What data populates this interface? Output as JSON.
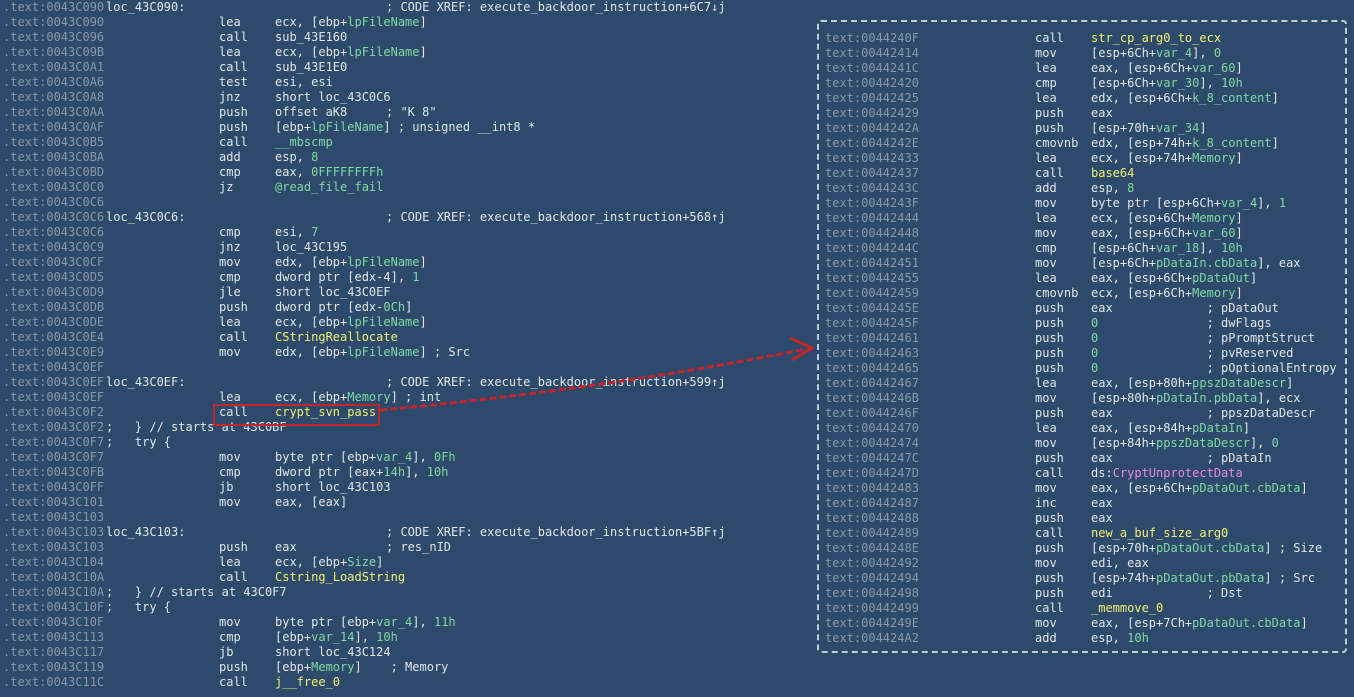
{
  "listing": [
    {
      "a": ".text:0043C090",
      "l": "loc_43C090:",
      "c": "; CODE XREF: execute_backdoor_instruction+6C7↓j"
    },
    {
      "a": ".text:0043C090",
      "m": "lea",
      "o": [
        [
          "ecx, [ebp+",
          "p"
        ],
        [
          "lpFileName",
          "s"
        ],
        [
          "]",
          "p"
        ]
      ]
    },
    {
      "a": ".text:0043C096",
      "m": "call",
      "o": [
        [
          "sub_43E160",
          "p"
        ]
      ]
    },
    {
      "a": ".text:0043C09B",
      "m": "lea",
      "o": [
        [
          "ecx, [ebp+",
          "p"
        ],
        [
          "lpFileName",
          "s"
        ],
        [
          "]",
          "p"
        ]
      ]
    },
    {
      "a": ".text:0043C0A1",
      "m": "call",
      "o": [
        [
          "sub_43E1E0",
          "p"
        ]
      ]
    },
    {
      "a": ".text:0043C0A6",
      "m": "test",
      "o": [
        [
          "esi, esi",
          "p"
        ]
      ]
    },
    {
      "a": ".text:0043C0A8",
      "m": "jnz",
      "o": [
        [
          "short loc_43C0C6",
          "p"
        ]
      ]
    },
    {
      "a": ".text:0043C0AA",
      "m": "push",
      "o": [
        [
          "offset aK8",
          "p"
        ]
      ],
      "c": "; \"K 8\""
    },
    {
      "a": ".text:0043C0AF",
      "m": "push",
      "o": [
        [
          "[ebp+",
          "p"
        ],
        [
          "lpFileName",
          "s"
        ],
        [
          "] ; unsigned __int8 *",
          "p"
        ]
      ]
    },
    {
      "a": ".text:0043C0B5",
      "m": "call",
      "o": [
        [
          "__mbscmp",
          "s"
        ]
      ]
    },
    {
      "a": ".text:0043C0BA",
      "m": "add",
      "o": [
        [
          "esp, ",
          "p"
        ],
        [
          "8",
          "s"
        ]
      ]
    },
    {
      "a": ".text:0043C0BD",
      "m": "cmp",
      "o": [
        [
          "eax, ",
          "p"
        ],
        [
          "0FFFFFFFFh",
          "s"
        ]
      ]
    },
    {
      "a": ".text:0043C0C0",
      "m": "jz",
      "o": [
        [
          "@read_file_fail",
          "s"
        ]
      ]
    },
    {
      "a": ".text:0043C0C6"
    },
    {
      "a": ".text:0043C0C6",
      "l": "loc_43C0C6:",
      "c": "; CODE XREF: execute_backdoor_instruction+568↑j"
    },
    {
      "a": ".text:0043C0C6",
      "m": "cmp",
      "o": [
        [
          "esi, ",
          "p"
        ],
        [
          "7",
          "s"
        ]
      ]
    },
    {
      "a": ".text:0043C0C9",
      "m": "jnz",
      "o": [
        [
          "loc_43C195",
          "p"
        ]
      ]
    },
    {
      "a": ".text:0043C0CF",
      "m": "mov",
      "o": [
        [
          "edx, [ebp+",
          "p"
        ],
        [
          "lpFileName",
          "s"
        ],
        [
          "]",
          "p"
        ]
      ]
    },
    {
      "a": ".text:0043C0D5",
      "m": "cmp",
      "o": [
        [
          "dword ptr [edx-4], ",
          "p"
        ],
        [
          "1",
          "s"
        ]
      ]
    },
    {
      "a": ".text:0043C0D9",
      "m": "jle",
      "o": [
        [
          "short loc_43C0EF",
          "p"
        ]
      ]
    },
    {
      "a": ".text:0043C0DB",
      "m": "push",
      "o": [
        [
          "dword ptr [edx-",
          "p"
        ],
        [
          "0Ch",
          "s"
        ],
        [
          "]",
          "p"
        ]
      ]
    },
    {
      "a": ".text:0043C0DE",
      "m": "lea",
      "o": [
        [
          "ecx, [ebp+",
          "p"
        ],
        [
          "lpFileName",
          "s"
        ],
        [
          "]",
          "p"
        ]
      ]
    },
    {
      "a": ".text:0043C0E4",
      "m": "call",
      "o": [
        [
          "CStringReallocate",
          "f"
        ]
      ]
    },
    {
      "a": ".text:0043C0E9",
      "m": "mov",
      "o": [
        [
          "edx, [ebp+",
          "p"
        ],
        [
          "lpFileName",
          "s"
        ],
        [
          "] ; Src",
          "p"
        ]
      ]
    },
    {
      "a": ".text:0043C0EF"
    },
    {
      "a": ".text:0043C0EF",
      "l": "loc_43C0EF:",
      "c": "; CODE XREF: execute_backdoor_instruction+599↑j"
    },
    {
      "a": ".text:0043C0EF",
      "m": "lea",
      "o": [
        [
          "ecx, [ebp+",
          "p"
        ],
        [
          "Memory",
          "s"
        ],
        [
          "] ; int",
          "p"
        ]
      ]
    },
    {
      "a": ".text:0043C0F2",
      "m": "call",
      "o": [
        [
          "crypt_svn_pass",
          "f"
        ]
      ]
    },
    {
      "a": ".text:0043C0F2",
      "t": ";   } // starts at 43C0BF"
    },
    {
      "a": ".text:0043C0F7",
      "t": ";   try {"
    },
    {
      "a": ".text:0043C0F7",
      "m": "mov",
      "o": [
        [
          "byte ptr [ebp+",
          "p"
        ],
        [
          "var_4",
          "s"
        ],
        [
          "], ",
          "p"
        ],
        [
          "0Fh",
          "s"
        ]
      ]
    },
    {
      "a": ".text:0043C0FB",
      "m": "cmp",
      "o": [
        [
          "dword ptr [eax+",
          "p"
        ],
        [
          "14h",
          "s"
        ],
        [
          "], ",
          "p"
        ],
        [
          "10h",
          "s"
        ]
      ]
    },
    {
      "a": ".text:0043C0FF",
      "m": "jb",
      "o": [
        [
          "short loc_43C103",
          "p"
        ]
      ]
    },
    {
      "a": ".text:0043C101",
      "m": "mov",
      "o": [
        [
          "eax, [eax]",
          "p"
        ]
      ]
    },
    {
      "a": ".text:0043C103"
    },
    {
      "a": ".text:0043C103",
      "l": "loc_43C103:",
      "c": "; CODE XREF: execute_backdoor_instruction+5BF↑j"
    },
    {
      "a": ".text:0043C103",
      "m": "push",
      "o": [
        [
          "eax",
          "p"
        ]
      ],
      "c": "; res_nID"
    },
    {
      "a": ".text:0043C104",
      "m": "lea",
      "o": [
        [
          "ecx, [ebp+",
          "p"
        ],
        [
          "Size",
          "s"
        ],
        [
          "]",
          "p"
        ]
      ]
    },
    {
      "a": ".text:0043C10A",
      "m": "call",
      "o": [
        [
          "Cstring_LoadString",
          "f"
        ]
      ]
    },
    {
      "a": ".text:0043C10A",
      "t": ";   } // starts at 43C0F7"
    },
    {
      "a": ".text:0043C10F",
      "t": ";   try {"
    },
    {
      "a": ".text:0043C10F",
      "m": "mov",
      "o": [
        [
          "byte ptr [ebp+",
          "p"
        ],
        [
          "var_4",
          "s"
        ],
        [
          "], ",
          "p"
        ],
        [
          "11h",
          "s"
        ]
      ]
    },
    {
      "a": ".text:0043C113",
      "m": "cmp",
      "o": [
        [
          "[ebp+",
          "p"
        ],
        [
          "var_14",
          "s"
        ],
        [
          "], ",
          "p"
        ],
        [
          "10h",
          "s"
        ]
      ]
    },
    {
      "a": ".text:0043C117",
      "m": "jb",
      "o": [
        [
          "short loc_43C124",
          "p"
        ]
      ]
    },
    {
      "a": ".text:0043C119",
      "m": "push",
      "o": [
        [
          "[ebp+",
          "p"
        ],
        [
          "Memory",
          "s"
        ],
        [
          "]    ; Memory",
          "p"
        ]
      ]
    },
    {
      "a": ".text:0043C11C",
      "m": "call",
      "o": [
        [
          "j__free_0",
          "f"
        ]
      ]
    }
  ],
  "popup": [
    {
      "a": "text:0044240F",
      "m": "call",
      "o": [
        [
          "str_cp_arg0_to_ecx",
          "f"
        ]
      ]
    },
    {
      "a": "text:00442414",
      "m": "mov",
      "o": [
        [
          "[esp+6Ch+",
          "p"
        ],
        [
          "var_4",
          "s"
        ],
        [
          "], ",
          "p"
        ],
        [
          "0",
          "s"
        ]
      ]
    },
    {
      "a": "text:0044241C",
      "m": "lea",
      "o": [
        [
          "eax, [esp+6Ch+",
          "p"
        ],
        [
          "var_60",
          "s"
        ],
        [
          "]",
          "p"
        ]
      ]
    },
    {
      "a": "text:00442420",
      "m": "cmp",
      "o": [
        [
          "[esp+6Ch+",
          "p"
        ],
        [
          "var_30",
          "s"
        ],
        [
          "], ",
          "p"
        ],
        [
          "10h",
          "s"
        ]
      ]
    },
    {
      "a": "text:00442425",
      "m": "lea",
      "o": [
        [
          "edx, [esp+6Ch+",
          "p"
        ],
        [
          "k_8_content",
          "s"
        ],
        [
          "]",
          "p"
        ]
      ]
    },
    {
      "a": "text:00442429",
      "m": "push",
      "o": [
        [
          "eax",
          "p"
        ]
      ]
    },
    {
      "a": "text:0044242A",
      "m": "push",
      "o": [
        [
          "[esp+70h+",
          "p"
        ],
        [
          "var_34",
          "s"
        ],
        [
          "]",
          "p"
        ]
      ]
    },
    {
      "a": "text:0044242E",
      "m": "cmovnb",
      "o": [
        [
          "edx, [esp+74h+",
          "p"
        ],
        [
          "k_8_content",
          "s"
        ],
        [
          "]",
          "p"
        ]
      ]
    },
    {
      "a": "text:00442433",
      "m": "lea",
      "o": [
        [
          "ecx, [esp+74h+",
          "p"
        ],
        [
          "Memory",
          "s"
        ],
        [
          "]",
          "p"
        ]
      ]
    },
    {
      "a": "text:00442437",
      "m": "call",
      "o": [
        [
          "base64",
          "f"
        ]
      ]
    },
    {
      "a": "text:0044243C",
      "m": "add",
      "o": [
        [
          "esp, ",
          "p"
        ],
        [
          "8",
          "s"
        ]
      ]
    },
    {
      "a": "text:0044243F",
      "m": "mov",
      "o": [
        [
          "byte ptr [esp+6Ch+",
          "p"
        ],
        [
          "var_4",
          "s"
        ],
        [
          "], ",
          "p"
        ],
        [
          "1",
          "s"
        ]
      ]
    },
    {
      "a": "text:00442444",
      "m": "lea",
      "o": [
        [
          "ecx, [esp+6Ch+",
          "p"
        ],
        [
          "Memory",
          "s"
        ],
        [
          "]",
          "p"
        ]
      ]
    },
    {
      "a": "text:00442448",
      "m": "mov",
      "o": [
        [
          "eax, [esp+6Ch+",
          "p"
        ],
        [
          "var_60",
          "s"
        ],
        [
          "]",
          "p"
        ]
      ]
    },
    {
      "a": "text:0044244C",
      "m": "cmp",
      "o": [
        [
          "[esp+6Ch+",
          "p"
        ],
        [
          "var_18",
          "s"
        ],
        [
          "], ",
          "p"
        ],
        [
          "10h",
          "s"
        ]
      ]
    },
    {
      "a": "text:00442451",
      "m": "mov",
      "o": [
        [
          "[esp+6Ch+",
          "p"
        ],
        [
          "pDataIn.cbData",
          "s"
        ],
        [
          "], eax",
          "p"
        ]
      ]
    },
    {
      "a": "text:00442455",
      "m": "lea",
      "o": [
        [
          "eax, [esp+6Ch+",
          "p"
        ],
        [
          "pDataOut",
          "s"
        ],
        [
          "]",
          "p"
        ]
      ]
    },
    {
      "a": "text:00442459",
      "m": "cmovnb",
      "o": [
        [
          "ecx, [esp+6Ch+",
          "p"
        ],
        [
          "Memory",
          "s"
        ],
        [
          "]",
          "p"
        ]
      ]
    },
    {
      "a": "text:0044245E",
      "m": "push",
      "o": [
        [
          "eax             ; pDataOut",
          "p"
        ]
      ]
    },
    {
      "a": "text:0044245F",
      "m": "push",
      "o": [
        [
          "0",
          "s"
        ],
        [
          "               ; dwFlags",
          "p"
        ]
      ]
    },
    {
      "a": "text:00442461",
      "m": "push",
      "o": [
        [
          "0",
          "s"
        ],
        [
          "               ; pPromptStruct",
          "p"
        ]
      ]
    },
    {
      "a": "text:00442463",
      "m": "push",
      "o": [
        [
          "0",
          "s"
        ],
        [
          "               ; pvReserved",
          "p"
        ]
      ]
    },
    {
      "a": "text:00442465",
      "m": "push",
      "o": [
        [
          "0",
          "s"
        ],
        [
          "               ; pOptionalEntropy",
          "p"
        ]
      ]
    },
    {
      "a": "text:00442467",
      "m": "lea",
      "o": [
        [
          "eax, [esp+80h+",
          "p"
        ],
        [
          "ppszDataDescr",
          "s"
        ],
        [
          "]",
          "p"
        ]
      ]
    },
    {
      "a": "text:0044246B",
      "m": "mov",
      "o": [
        [
          "[esp+80h+",
          "p"
        ],
        [
          "pDataIn.pbData",
          "s"
        ],
        [
          "], ecx",
          "p"
        ]
      ]
    },
    {
      "a": "text:0044246F",
      "m": "push",
      "o": [
        [
          "eax             ; ppszDataDescr",
          "p"
        ]
      ]
    },
    {
      "a": "text:00442470",
      "m": "lea",
      "o": [
        [
          "eax, [esp+84h+",
          "p"
        ],
        [
          "pDataIn",
          "s"
        ],
        [
          "]",
          "p"
        ]
      ]
    },
    {
      "a": "text:00442474",
      "m": "mov",
      "o": [
        [
          "[esp+84h+",
          "p"
        ],
        [
          "ppszDataDescr",
          "s"
        ],
        [
          "], ",
          "p"
        ],
        [
          "0",
          "s"
        ]
      ]
    },
    {
      "a": "text:0044247C",
      "m": "push",
      "o": [
        [
          "eax             ; pDataIn",
          "p"
        ]
      ]
    },
    {
      "a": "text:0044247D",
      "m": "call",
      "o": [
        [
          "ds:",
          "p"
        ],
        [
          "CryptUnprotectData",
          "i"
        ]
      ]
    },
    {
      "a": "text:00442483",
      "m": "mov",
      "o": [
        [
          "eax, [esp+6Ch+",
          "p"
        ],
        [
          "pDataOut.cbData",
          "s"
        ],
        [
          "]",
          "p"
        ]
      ]
    },
    {
      "a": "text:00442487",
      "m": "inc",
      "o": [
        [
          "eax",
          "p"
        ]
      ]
    },
    {
      "a": "text:00442488",
      "m": "push",
      "o": [
        [
          "eax",
          "p"
        ]
      ]
    },
    {
      "a": "text:00442489",
      "m": "call",
      "o": [
        [
          "new_a_buf_size_arg0",
          "f"
        ]
      ]
    },
    {
      "a": "text:0044248E",
      "m": "push",
      "o": [
        [
          "[esp+70h+",
          "p"
        ],
        [
          "pDataOut.cbData",
          "s"
        ],
        [
          "] ; Size",
          "p"
        ]
      ]
    },
    {
      "a": "text:00442492",
      "m": "mov",
      "o": [
        [
          "edi, eax",
          "p"
        ]
      ]
    },
    {
      "a": "text:00442494",
      "m": "push",
      "o": [
        [
          "[esp+74h+",
          "p"
        ],
        [
          "pDataOut.pbData",
          "s"
        ],
        [
          "] ; Src",
          "p"
        ]
      ]
    },
    {
      "a": "text:00442498",
      "m": "push",
      "o": [
        [
          "edi             ; Dst",
          "p"
        ]
      ]
    },
    {
      "a": "text:00442499",
      "m": "call",
      "o": [
        [
          "_memmove_0",
          "f"
        ]
      ]
    },
    {
      "a": "text:0044249E",
      "m": "mov",
      "o": [
        [
          "eax, [esp+7Ch+",
          "p"
        ],
        [
          "pDataOut.cbData",
          "s"
        ],
        [
          "]",
          "p"
        ]
      ]
    },
    {
      "a": "text:004424A2",
      "m": "add",
      "o": [
        [
          "esp, ",
          "p"
        ],
        [
          "10h",
          "s"
        ]
      ]
    }
  ],
  "colors": {
    "background": "#2d4a6d",
    "address": "#8a97a6",
    "text": "#e2e6ea",
    "symbol": "#7fd9a2",
    "function": "#f3f06e",
    "import": "#e68ad8",
    "highlight": "#c0262b",
    "popup_border": "#c4cdd6"
  }
}
